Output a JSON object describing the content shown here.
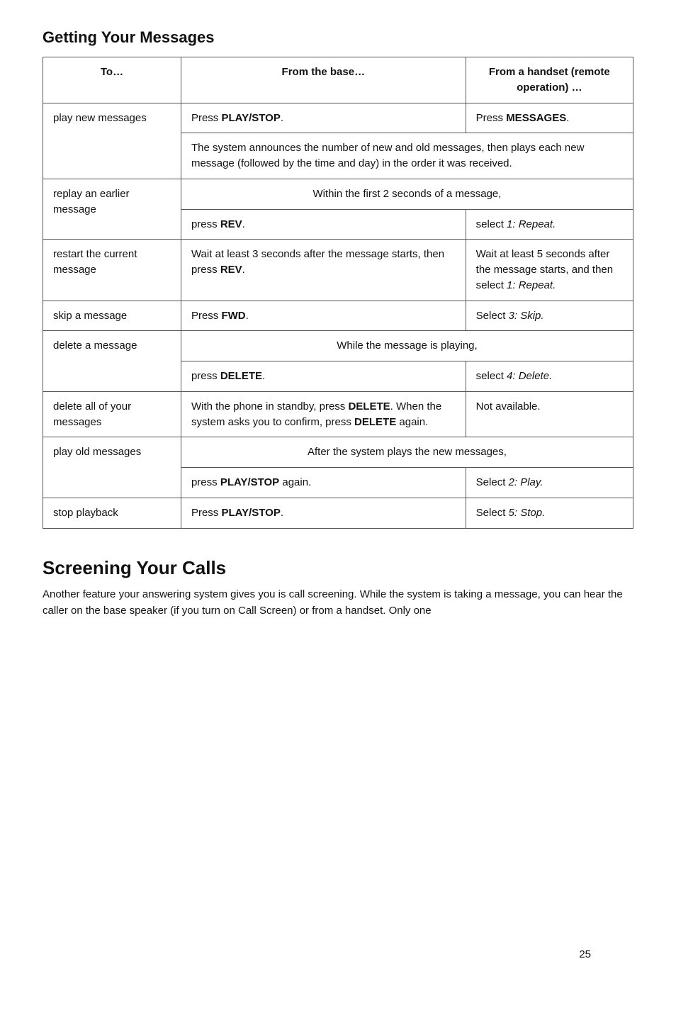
{
  "section1": {
    "title": "Getting Your Messages",
    "table": {
      "headers": {
        "col1": "To…",
        "col2": "From the base…",
        "col3": "From a handset (remote operation) …"
      },
      "rows": [
        {
          "to": "play new messages",
          "base_line1": "Press PLAY/STOP.",
          "base_line1_bold": "PLAY/STOP",
          "base_line2": "The system announces the number of new and old messages, then plays each new message (followed by the time and day) in the order it was received.",
          "handset_line1": "Press MESSAGES.",
          "handset_line1_bold": "MESSAGES",
          "handset_line2": "",
          "merged_base_handset": false,
          "row_span_base": false
        },
        {
          "to": "replay an earlier message",
          "base_line1": "Within the first 2 seconds of a message,",
          "base_line2": "press REV.",
          "base_line2_bold": "REV",
          "handset_line1": "select 1: Repeat.",
          "handset_italic": "1: Repeat",
          "merged_top": true
        },
        {
          "to": "restart the current message",
          "base_line1": "Wait at least 3 seconds after the message starts, then press REV.",
          "base_bold": "REV",
          "handset_line1": "Wait at least 5 seconds after the message starts, and then select 1: Repeat.",
          "handset_italic": "1: Repeat."
        },
        {
          "to": "skip a message",
          "base_line1": "Press FWD.",
          "base_bold": "FWD",
          "handset_line1": "Select 3: Skip.",
          "handset_italic": "3: Skip"
        },
        {
          "to": "delete a message",
          "base_line1": "While the message is playing,",
          "base_line2": "press DELETE.",
          "base_bold": "DELETE",
          "handset_line1": "select 4: Delete.",
          "handset_italic": "4: Delete",
          "merged_top": true
        },
        {
          "to": "delete all of your messages",
          "base_line1": "With the phone in standby, press DELETE. When the system asks you to confirm, press DELETE again.",
          "base_bold1": "DELETE",
          "base_bold2": "DELETE",
          "handset_line1": "Not available."
        },
        {
          "to": "play old messages",
          "base_line1": "After the system plays the new messages,",
          "base_line2": "press PLAY/STOP again.",
          "base_bold": "PLAY/STOP",
          "handset_line1": "Select 2: Play.",
          "handset_italic": "2: Play",
          "merged_top": true
        },
        {
          "to": "stop playback",
          "base_line1": "Press PLAY/STOP.",
          "base_bold": "PLAY/STOP",
          "handset_line1": "Select 5: Stop.",
          "handset_italic": "5: Stop"
        }
      ]
    }
  },
  "section2": {
    "title": "Screening Your Calls",
    "body": "Another feature your answering system gives you is call screening. While the system is taking a message, you can hear the caller on the base speaker (if you turn on Call Screen) or from a handset. Only one"
  },
  "page": {
    "number": "25"
  }
}
